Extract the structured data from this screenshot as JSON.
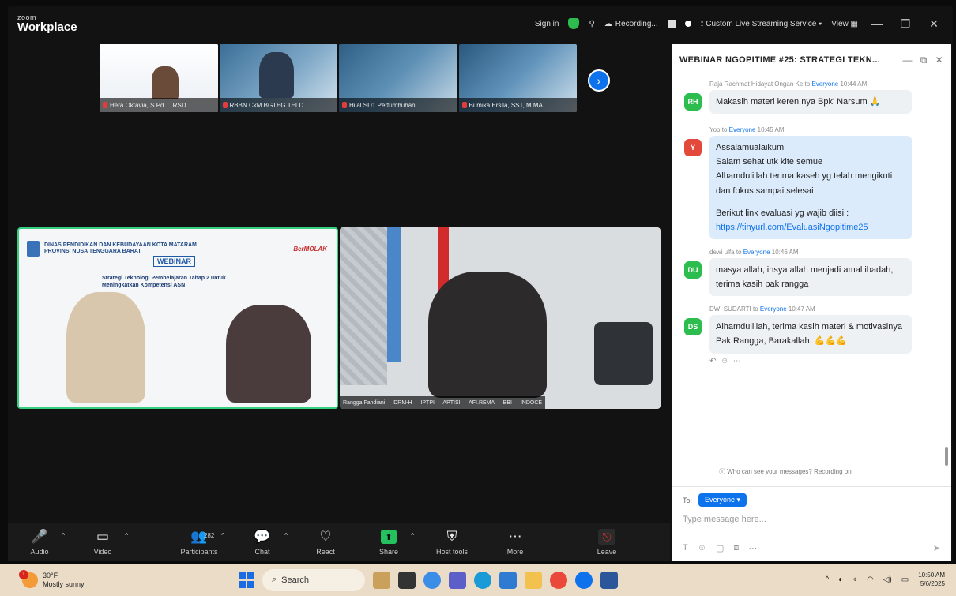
{
  "app": {
    "logo_small": "zoom",
    "logo_name": "Workplace"
  },
  "titlebar": {
    "sign_in": "Sign in",
    "recording": "Recording...",
    "live_stream": "Custom Live Streaming Service",
    "view": "View",
    "minimize": "—",
    "maximize": "❐",
    "close": "✕"
  },
  "thumbnails": [
    {
      "name": "Hera Oktavia, S.Pd.... RSD"
    },
    {
      "name": "RBBN CkM BGTEG TELD"
    },
    {
      "name": "Hilal SD1 Pertumbuhan"
    },
    {
      "name": "Bumika Ersila, SST, M.MA"
    }
  ],
  "stage": {
    "left_slide": {
      "org_line1": "DINAS PENDIDIKAN DAN KEBUDAYAAN KOTA MATARAM",
      "org_line2": "PROVINSI NUSA TENGGARA BARAT",
      "brand": "BerMOLAK",
      "webinar": "WEBINAR",
      "title": "Strategi Teknologi Pembelajaran Tahap 2 untuk Meningkatkan Kompetensi ASN"
    },
    "right_name": "Rangga Fahdiani — DRM-H — IPTPI — APTISI — AFI.REMA — BBI — INDOCE"
  },
  "toolbar": {
    "audio": "Audio",
    "video": "Video",
    "participants": "Participants",
    "participants_count": "282",
    "chat": "Chat",
    "react": "React",
    "share": "Share",
    "host_tools": "Host tools",
    "more": "More",
    "leave": "Leave"
  },
  "chat": {
    "title": "WEBINAR NGOPITIME #25: STRATEGI TEKN...",
    "messages": [
      {
        "avatar": "RH",
        "avatar_color": "#2dbd4e",
        "sender": "Raja Rachmat Hidayat Ongan Ke",
        "to": "to",
        "recipient": "Everyone",
        "time": "10:44 AM",
        "text": "Makasih materi keren nya Bpk' Narsum 🙏"
      },
      {
        "avatar": "Y",
        "avatar_color": "#e2493a",
        "sender": "Yoo",
        "to": "to",
        "recipient": "Everyone",
        "time": "10:45 AM",
        "lines": [
          "Assalamualaikum",
          "Salam sehat utk kite semue",
          "Alhamdulillah terima kaseh yg telah mengikuti dan fokus sampai selesai",
          "",
          "Berikut link evaluasi yg wajib diisi :"
        ],
        "link": "https://tinyurl.com/EvaluasiNgopitime25"
      },
      {
        "avatar": "DU",
        "avatar_color": "#2dbd4e",
        "sender": "dewi ulfa",
        "to": "to",
        "recipient": "Everyone",
        "time": "10:46 AM",
        "text": "masya allah, insya allah menjadi amal ibadah, terima kasih pak rangga"
      },
      {
        "avatar": "DS",
        "avatar_color": "#2dbd4e",
        "sender": "DWI SUDARTI",
        "to": "to",
        "recipient": "Everyone",
        "time": "10:47 AM",
        "text": "Alhamdulillah, terima kasih materi & motivasinya Pak Rangga, Barakallah. 💪💪💪"
      }
    ],
    "privacy_note": "Who can see your messages? Recording on",
    "to_label": "To:",
    "to_value": "Everyone",
    "placeholder": "Type message here..."
  },
  "taskbar": {
    "temp": "30°F",
    "condition": "Mostly sunny",
    "search": "Search",
    "time": "10:50 AM",
    "date": "5/6/2025"
  },
  "colors": {
    "accent": "#0e72ed",
    "active_speaker": "#35d07f",
    "share_green": "#26c15f"
  }
}
